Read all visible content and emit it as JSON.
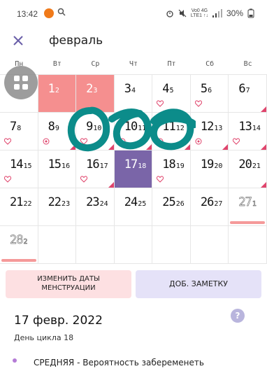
{
  "status_bar": {
    "time": "13:42",
    "battery": "30%",
    "network_top": "Vo0 4G",
    "network_bottom": "LTE1 ↑↓"
  },
  "header": {
    "month": "февраль",
    "close_icon": "close-icon"
  },
  "weekdays": [
    "Пн",
    "Вт",
    "Ср",
    "Чт",
    "Пт",
    "Сб",
    "Вс"
  ],
  "calendar": {
    "rows": [
      [
        {
          "day": "",
          "sub": "",
          "state": "empty"
        },
        {
          "day": "1",
          "sub": "2",
          "state": "period"
        },
        {
          "day": "2",
          "sub": "3",
          "state": "period"
        },
        {
          "day": "3",
          "sub": "4",
          "state": "normal"
        },
        {
          "day": "4",
          "sub": "5",
          "state": "normal",
          "heart": true
        },
        {
          "day": "5",
          "sub": "6",
          "state": "normal",
          "heart": true
        },
        {
          "day": "6",
          "sub": "7",
          "state": "normal",
          "tri": true
        }
      ],
      [
        {
          "day": "7",
          "sub": "8",
          "state": "normal",
          "heart": true
        },
        {
          "day": "8",
          "sub": "9",
          "state": "normal",
          "target": true,
          "tri": true
        },
        {
          "day": "9",
          "sub": "10",
          "state": "normal",
          "heart": true,
          "tri": true
        },
        {
          "day": "10",
          "sub": "11",
          "state": "normal",
          "target": true,
          "tri": true
        },
        {
          "day": "11",
          "sub": "12",
          "state": "normal",
          "target": true,
          "tri": true
        },
        {
          "day": "12",
          "sub": "13",
          "state": "normal",
          "target": true,
          "tri": true
        },
        {
          "day": "13",
          "sub": "14",
          "state": "normal",
          "heart": true,
          "tri": true
        }
      ],
      [
        {
          "day": "14",
          "sub": "15",
          "state": "normal",
          "heart": true
        },
        {
          "day": "15",
          "sub": "16",
          "state": "normal"
        },
        {
          "day": "16",
          "sub": "17",
          "state": "normal",
          "heart": true,
          "tri": true
        },
        {
          "day": "17",
          "sub": "18",
          "state": "today"
        },
        {
          "day": "18",
          "sub": "19",
          "state": "normal",
          "heart": true
        },
        {
          "day": "19",
          "sub": "20",
          "state": "normal"
        },
        {
          "day": "20",
          "sub": "21",
          "state": "normal",
          "tri": true
        }
      ],
      [
        {
          "day": "21",
          "sub": "22",
          "state": "normal"
        },
        {
          "day": "22",
          "sub": "23",
          "state": "normal"
        },
        {
          "day": "23",
          "sub": "24",
          "state": "normal"
        },
        {
          "day": "24",
          "sub": "25",
          "state": "normal"
        },
        {
          "day": "25",
          "sub": "26",
          "state": "normal"
        },
        {
          "day": "26",
          "sub": "27",
          "state": "normal"
        },
        {
          "day": "27",
          "sub": "1",
          "state": "outline",
          "pinkbar": true
        }
      ],
      [
        {
          "day": "28",
          "sub": "2",
          "state": "outline",
          "pinkbar": true
        },
        {
          "day": "",
          "sub": "",
          "state": "empty"
        },
        {
          "day": "",
          "sub": "",
          "state": "empty"
        },
        {
          "day": "",
          "sub": "",
          "state": "empty"
        },
        {
          "day": "",
          "sub": "",
          "state": "empty"
        },
        {
          "day": "",
          "sub": "",
          "state": "empty"
        },
        {
          "day": "",
          "sub": "",
          "state": "empty"
        }
      ]
    ]
  },
  "actions": {
    "change_period_line1": "ИЗМЕНИТЬ ДАТЫ",
    "change_period_line2": "МЕНСТРУАЦИИ",
    "add_note": "ДОБ. ЗАМЕТКУ"
  },
  "details": {
    "date": "17 февр. 2022",
    "cycle_day": "День цикла 18",
    "probability_level": "СРЕДНЯЯ",
    "probability_text": "СРЕДНЯЯ - Вероятность забеременеть",
    "help": "?"
  },
  "colors": {
    "period": "#f58f8f",
    "today": "#7a65a8",
    "fertile_marker": "#e0446c",
    "scribble": "#0c8c8a"
  }
}
